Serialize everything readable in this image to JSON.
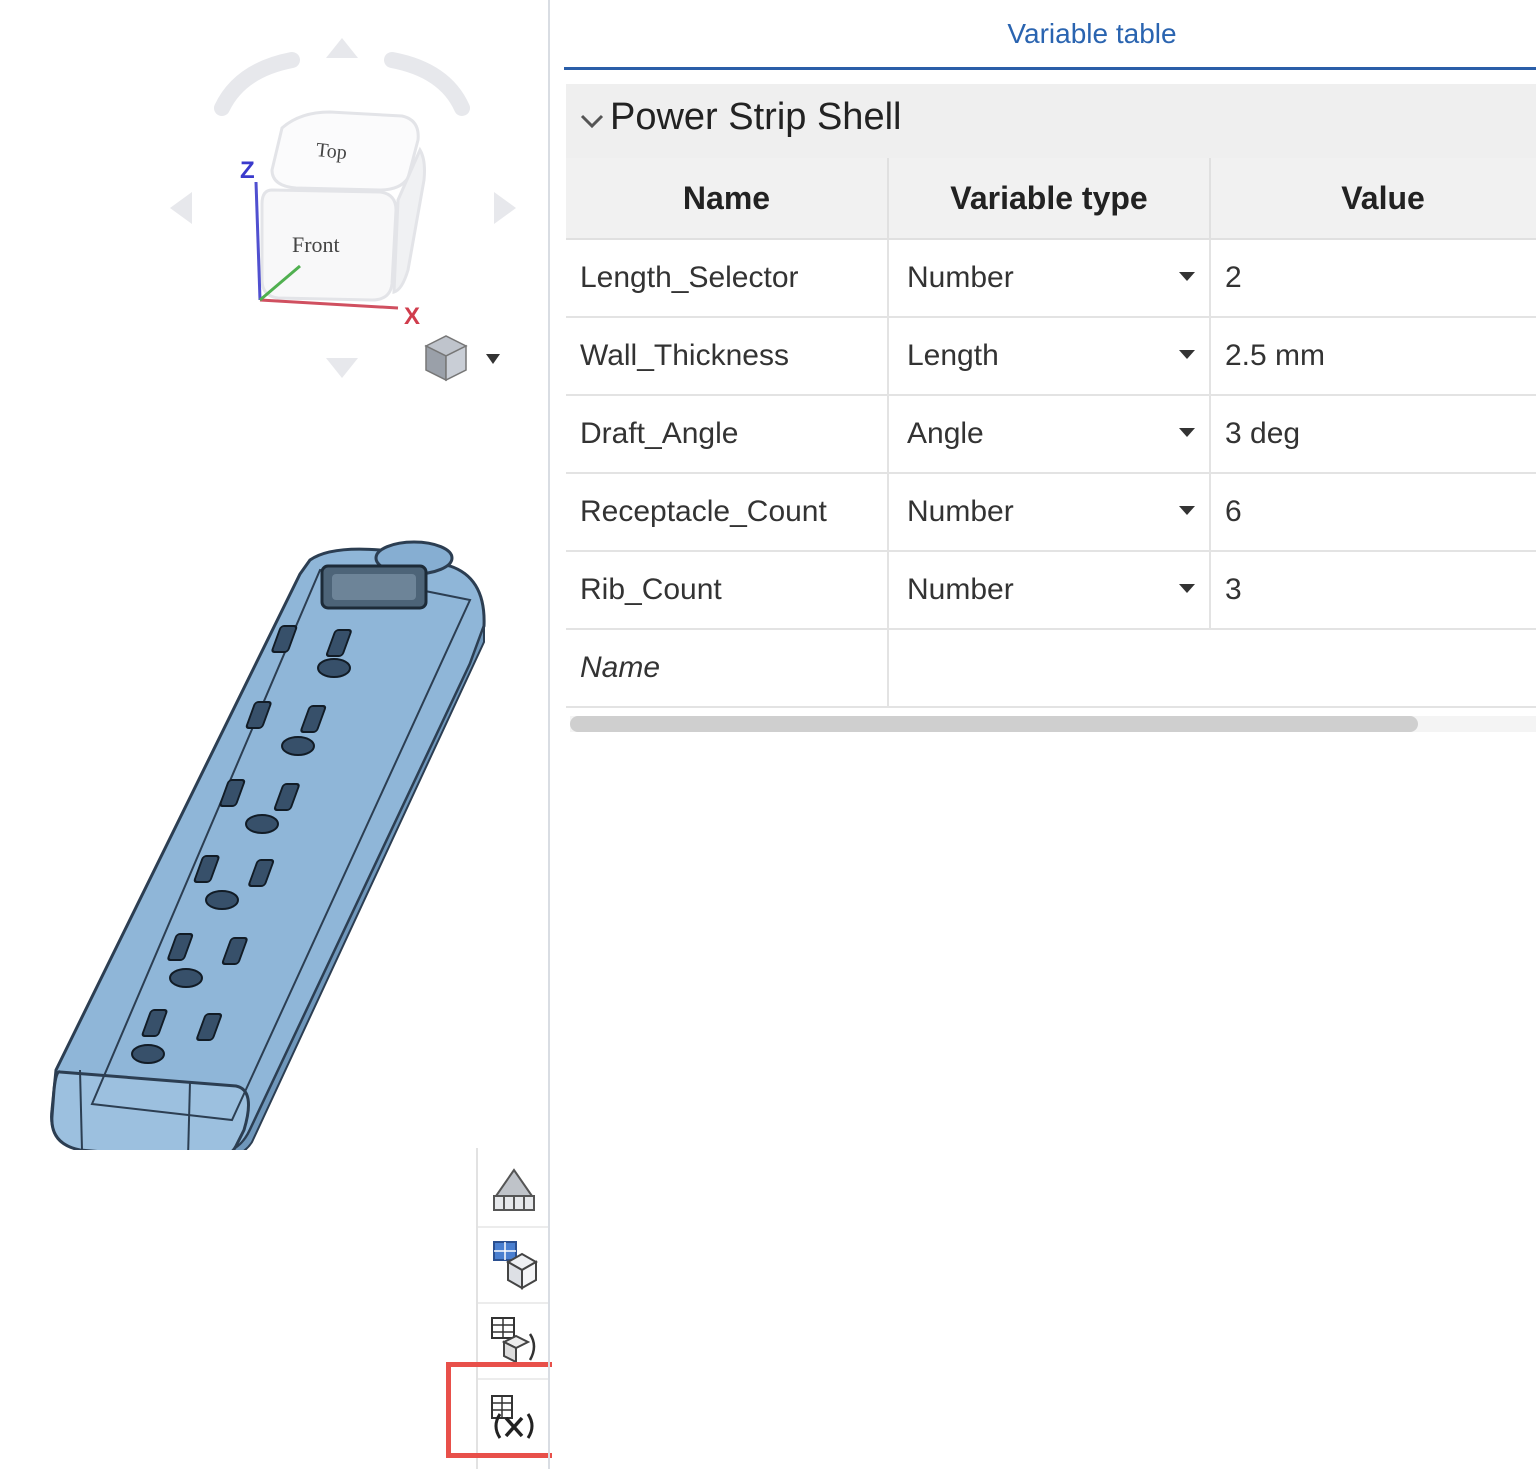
{
  "viewcube": {
    "top_label": "Top",
    "front_label": "Front",
    "axis_z": "Z",
    "axis_x": "X"
  },
  "panel": {
    "title": "Variable table",
    "group_title": "Power Strip Shell",
    "columns": [
      "Name",
      "Variable type",
      "Value"
    ],
    "rows": [
      {
        "name": "Length_Selector",
        "type": "Number",
        "value": "2"
      },
      {
        "name": "Wall_Thickness",
        "type": "Length",
        "value": "2.5 mm"
      },
      {
        "name": "Draft_Angle",
        "type": "Angle",
        "value": "3 deg"
      },
      {
        "name": "Receptacle_Count",
        "type": "Number",
        "value": "6"
      },
      {
        "name": "Rib_Count",
        "type": "Number",
        "value": "3"
      }
    ],
    "new_row_placeholder": "Name"
  },
  "toolbar": {
    "icons": [
      "configurations-icon",
      "variable-studio-icon",
      "assembly-variables-icon",
      "variable-table-icon"
    ]
  },
  "colors": {
    "accent": "#2a64b0",
    "highlight": "#e8504a",
    "model": "#8db4d6"
  }
}
